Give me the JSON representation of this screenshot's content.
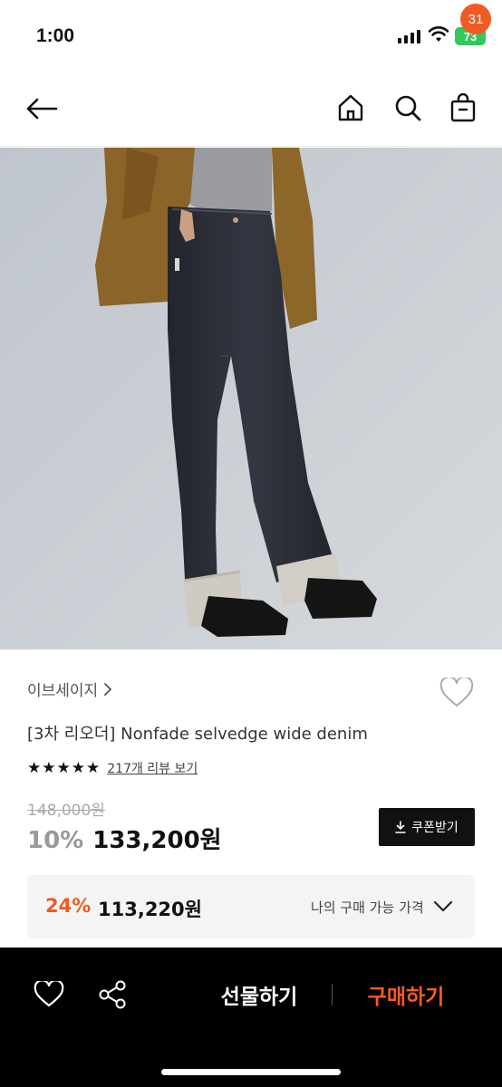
{
  "status_bar": {
    "time": "1:00",
    "battery": "73"
  },
  "nav": {
    "cart_count": "31"
  },
  "product": {
    "brand": "이브세이지",
    "title": "[3차 리오더] Nonfade selvedge wide denim",
    "rating_stars": 5,
    "review_link": "217개 리뷰 보기",
    "original_price": "148,000원",
    "discount_rate": "10%",
    "sale_price": "133,200원",
    "coupon_label": "쿠폰받기"
  },
  "my_price": {
    "rate": "24%",
    "price": "113,220원",
    "label": "나의 구매 가능 가격"
  },
  "bottom_bar": {
    "gift_label": "선물하기",
    "buy_label": "구매하기"
  },
  "colors": {
    "accent": "#f15a22",
    "buy": "#ff5a1f",
    "battery": "#34c759"
  }
}
